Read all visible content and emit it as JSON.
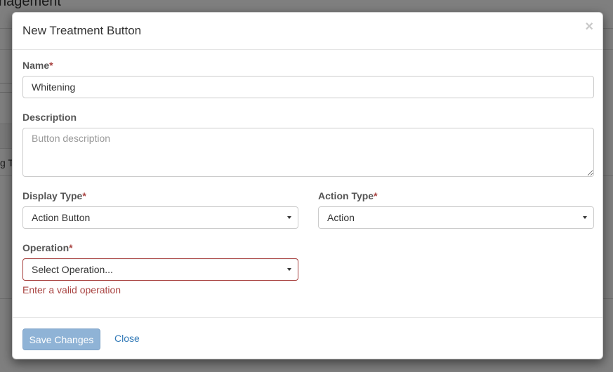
{
  "background": {
    "title_fragment": "nagement",
    "row_fragment": "g T"
  },
  "modal": {
    "title": "New Treatment Button",
    "close_symbol": "×",
    "fields": {
      "name": {
        "label": "Name",
        "required_mark": "*",
        "value": "Whitening"
      },
      "description": {
        "label": "Description",
        "placeholder": "Button description",
        "value": ""
      },
      "display_type": {
        "label": "Display Type",
        "required_mark": "*",
        "value": "Action Button"
      },
      "action_type": {
        "label": "Action Type",
        "required_mark": "*",
        "value": "Action"
      },
      "operation": {
        "label": "Operation",
        "required_mark": "*",
        "value": "Select Operation...",
        "error": "Enter a valid operation"
      }
    },
    "footer": {
      "save_label": "Save Changes",
      "close_label": "Close"
    }
  },
  "colors": {
    "primary": "#337ab7",
    "primary_disabled": "#8fb3d6",
    "error": "#a94442"
  }
}
